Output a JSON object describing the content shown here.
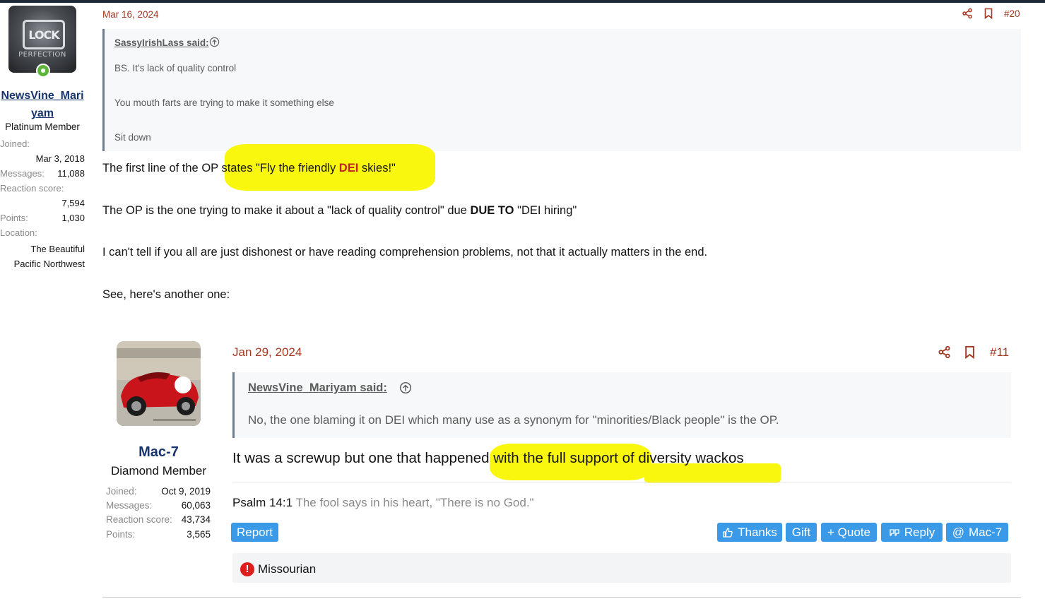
{
  "poster": {
    "avatar_text": "LOCK",
    "avatar_subtext": "PERFECTION",
    "name_line1": "NewsVine_Mari",
    "name_line2": "yam",
    "title": "Platinum Member",
    "stats": [
      {
        "label": "Joined:",
        "value": "Mar 3, 2018"
      },
      {
        "label": "Messages:",
        "value": "11,088"
      },
      {
        "label": "Reaction score:",
        "value": "7,594"
      },
      {
        "label": "Points:",
        "value": "1,030"
      },
      {
        "label": "Location:",
        "value": "The Beautiful Pacific Northwest"
      }
    ],
    "location_line1": "The Beautiful",
    "location_line2": "Pacific Northwest"
  },
  "post": {
    "date": "Mar 16, 2024",
    "number": "#20",
    "quote": {
      "author": "SassyIrishLass said:",
      "lines": [
        "BS. It's lack of quality control",
        "You mouth farts are trying to make it something else",
        "Sit down"
      ]
    },
    "line1_a": "The first line of the OP states \"Fly the friendly ",
    "line1_dei": "DEI",
    "line1_b": " skies!\"",
    "line2_a": "The OP is the one trying to make it about a \"lack of quality control\" due ",
    "line2_bold": "DUE TO",
    "line2_b": " \"DEI hiring\"",
    "line3": "I can't tell if you all are just dishonest or have reading comprehension problems, not that it actually matters in the end.",
    "line4": "See, here's another one:"
  },
  "embedded": {
    "name": "Mac-7",
    "title": "Diamond Member",
    "stats": [
      {
        "label": "Joined:",
        "value": "Oct 9, 2019"
      },
      {
        "label": "Messages:",
        "value": "60,063"
      },
      {
        "label": "Reaction score:",
        "value": "43,734"
      },
      {
        "label": "Points:",
        "value": "3,565"
      }
    ],
    "date": "Jan 29, 2024",
    "number": "#11",
    "quote_author": "NewsVine_Mariyam said:",
    "quote_text": "No, the one blaming it on DEI which many use as a synonym for \"minorities/Black people\" is the OP.",
    "body": "It was a screwup but one that happened with the full support of diversity wackos",
    "sig_ref": "Psalm 14:1",
    "sig_text": " The fool says in his heart, \"There is no God.\"",
    "buttons": {
      "report": "Report",
      "thanks": "Thanks",
      "gift": "Gift",
      "quote": "+ Quote",
      "reply": "Reply",
      "mention": "Mac-7"
    },
    "footer": "Missourian",
    "footer_alert": "!"
  },
  "colors": {
    "accent": "#a4371f",
    "link": "#17346f",
    "button": "#3a9ae8",
    "highlight": "#faf70f",
    "dei": "#c0231f"
  }
}
